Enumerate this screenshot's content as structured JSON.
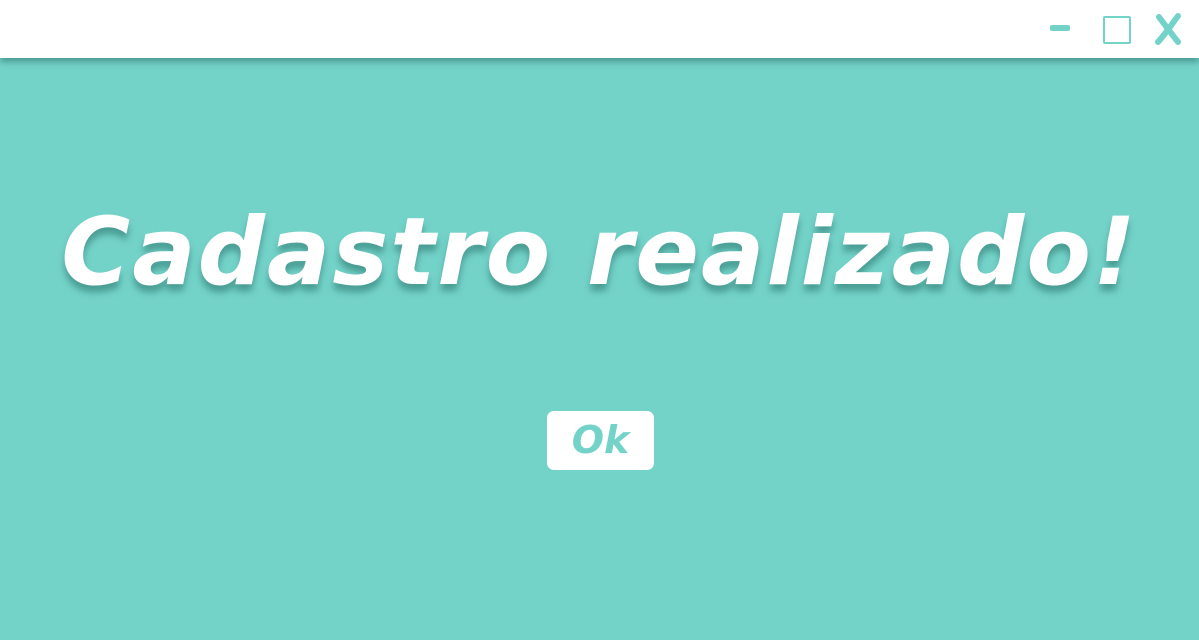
{
  "colors": {
    "background": "#74d3c9",
    "titlebar": "#ffffff",
    "accent": "#74d3c9",
    "text": "#ffffff"
  },
  "titlebar": {
    "controls": [
      {
        "name": "minimize",
        "icon": "minimize-icon"
      },
      {
        "name": "maximize",
        "icon": "maximize-icon"
      },
      {
        "name": "close",
        "icon": "close-icon",
        "glyph": "X"
      }
    ]
  },
  "dialog": {
    "message": "Cadastro realizado!",
    "ok_label": "Ok"
  }
}
